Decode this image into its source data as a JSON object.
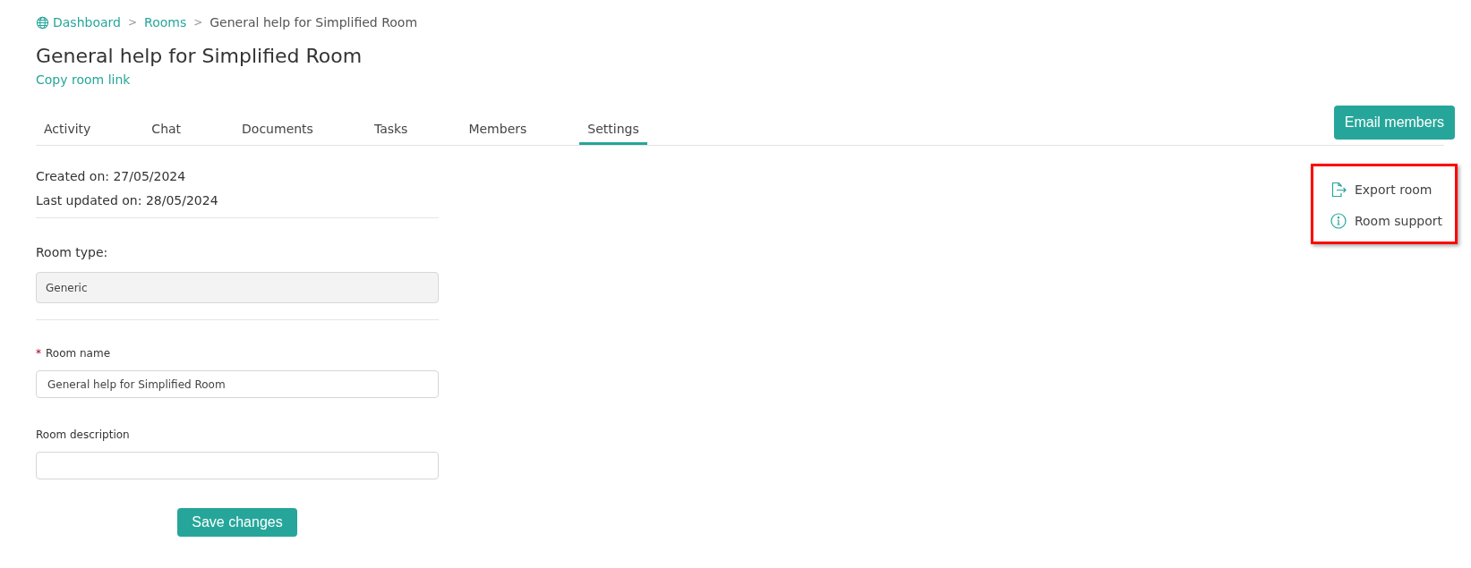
{
  "breadcrumb": [
    {
      "label": "Dashboard",
      "link": true
    },
    {
      "label": "Rooms",
      "link": true
    },
    {
      "label": "General help for Simplified Room",
      "link": false
    }
  ],
  "breadcrumb_separator": ">",
  "title": "General help for Simplified Room",
  "copy_link": "Copy room link",
  "tabs": [
    {
      "label": "Activity",
      "selected": false
    },
    {
      "label": "Chat",
      "selected": false
    },
    {
      "label": "Documents",
      "selected": false
    },
    {
      "label": "Tasks",
      "selected": false
    },
    {
      "label": "Members",
      "selected": false
    },
    {
      "label": "Settings",
      "selected": true
    }
  ],
  "email_button": "Email members",
  "actions": {
    "highlighted": true,
    "items": [
      {
        "label": "Export room",
        "kind": "export"
      },
      {
        "label": "Room support",
        "kind": "info"
      }
    ]
  },
  "created": "Created on: 27/05/2024",
  "updated": "Last updated on: 28/05/2024",
  "room_type": {
    "label": "Room type:",
    "value": "Generic",
    "disabled": true
  },
  "required_mark": "*",
  "room_name": {
    "label": "Room name",
    "required": true,
    "value": "General help for Simplified Room"
  },
  "room_description": {
    "label": "Room description",
    "required": false
  },
  "save_button": "Save changes"
}
